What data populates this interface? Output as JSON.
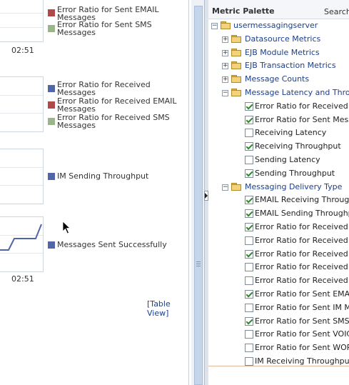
{
  "charts": [
    {
      "time_label": "02:51",
      "legend": [
        {
          "label": "Error Ratio for Sent EMAIL Messages",
          "color": "#b04a4a"
        },
        {
          "label": "Error Ratio for Sent SMS Messages",
          "color": "#9bb58a"
        }
      ]
    },
    {
      "legend": [
        {
          "label": "Error Ratio for Received Messages",
          "color": "#5166a8"
        },
        {
          "label": "Error Ratio for Received EMAIL Messages",
          "color": "#b04a4a"
        },
        {
          "label": "Error Ratio for Received SMS Messages",
          "color": "#9bb58a"
        }
      ]
    },
    {
      "legend": [
        {
          "label": "IM Sending Throughput",
          "color": "#5166a8"
        }
      ]
    },
    {
      "time_label": "02:51",
      "legend": [
        {
          "label": "Messages Sent Successfully",
          "color": "#5166a8"
        }
      ]
    }
  ],
  "table_view_link": "[Table View]",
  "palette": {
    "title": "Metric Palette",
    "search_label": "Search",
    "root": "usermessagingserver",
    "folders_collapsed": [
      "Datasource Metrics",
      "EJB Module Metrics",
      "EJB Transaction Metrics",
      "Message Counts"
    ],
    "latency_folder": {
      "label": "Message Latency and Throughput",
      "items": [
        {
          "label": "Error Ratio for Received Messages",
          "checked": true
        },
        {
          "label": "Error Ratio for Sent Messages",
          "checked": true
        },
        {
          "label": "Receiving Latency",
          "checked": false
        },
        {
          "label": "Receiving Throughput",
          "checked": true
        },
        {
          "label": "Sending Latency",
          "checked": false
        },
        {
          "label": "Sending Throughput",
          "checked": true
        }
      ]
    },
    "delivery_folder": {
      "label": "Messaging Delivery Type",
      "items": [
        {
          "label": "EMAIL Receiving Throughput",
          "checked": true
        },
        {
          "label": "EMAIL Sending Throughput",
          "checked": true
        },
        {
          "label": "Error Ratio for Received EMAIL Messages",
          "checked": true
        },
        {
          "label": "Error Ratio for Received IM Messages",
          "checked": false
        },
        {
          "label": "Error Ratio for Received SMS Messages",
          "checked": true
        },
        {
          "label": "Error Ratio for Received VOICE Messages",
          "checked": false
        },
        {
          "label": "Error Ratio for Received WORKLIST Messages",
          "checked": false
        },
        {
          "label": "Error Ratio for Sent EMAIL Messages",
          "checked": true
        },
        {
          "label": "Error Ratio for Sent IM Messages",
          "checked": false
        },
        {
          "label": "Error Ratio for Sent SMS Messages",
          "checked": true
        },
        {
          "label": "Error Ratio for Sent VOICE Messages",
          "checked": false
        },
        {
          "label": "Error Ratio for Sent WORKLIST Messages",
          "checked": false
        },
        {
          "label": "IM Receiving Throughput",
          "checked": false
        }
      ]
    }
  }
}
